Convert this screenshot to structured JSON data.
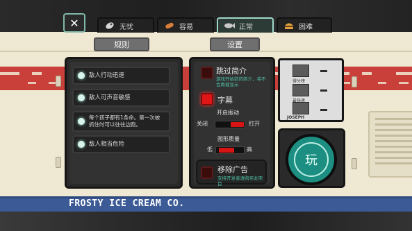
{
  "tabs": {
    "close_symbol": "✕",
    "items": [
      {
        "label": "无忧",
        "icon": "rocket-icon"
      },
      {
        "label": "容易",
        "icon": "sausage-icon"
      },
      {
        "label": "正常",
        "icon": "fish-icon"
      },
      {
        "label": "困难",
        "icon": "burger-icon"
      }
    ],
    "active_index": 2
  },
  "sections": {
    "rules_label": "规则",
    "settings_label": "设置"
  },
  "rules": [
    {
      "text": "敌人行动迅速"
    },
    {
      "text": "敌人可声音敏感"
    },
    {
      "text": "每个孩子都有1条命。第一次被抓住时可以往往边跑。"
    },
    {
      "text": "敌人相当危险"
    }
  ],
  "settings": {
    "skip_intro": {
      "title": "跳过简介",
      "sub": "游戏开始前的简介，将不会再被显示",
      "checked": false
    },
    "subtitles": {
      "title": "字幕",
      "checked": true
    },
    "open_door": {
      "title": "开启振动",
      "left": "关闭",
      "right": "打开",
      "value_percent": 40
    },
    "graphics": {
      "title": "图形质量",
      "left": "低",
      "right": "高",
      "value_percent": 45
    },
    "remove_ads": {
      "title": "移除广告",
      "sub": "支持开发者请购买此项目",
      "checked": false
    }
  },
  "leaderboard": {
    "rows": [
      {
        "label": "得分榜"
      },
      {
        "label": "最快速"
      },
      {
        "label": "JOSEPH"
      }
    ]
  },
  "play": {
    "label": "玩"
  },
  "truck": {
    "brand": "FROSTY ICE CREAM CO."
  },
  "colors": {
    "accent_red": "#c9403a",
    "truck_blue": "#3c5a96",
    "play_teal": "#1c8f82"
  }
}
